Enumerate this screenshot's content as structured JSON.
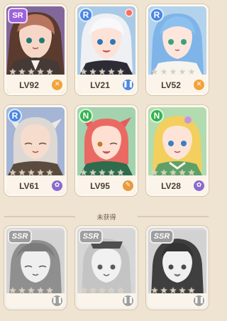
{
  "owned_heroes": [
    {
      "rarity": "SR",
      "level": "LV92",
      "class_icon": "crossed-swords-icon",
      "class_color": "#f2a33a",
      "bg": [
        "#9877a8",
        "#5f4f66"
      ],
      "stars": 5
    },
    {
      "rarity": "R",
      "level": "LV21",
      "class_icon": "pillars-icon",
      "class_color": "#4b86e3",
      "bg": [
        "#9ec3e3",
        "#6b8fb7"
      ],
      "stars": 5,
      "badge": true
    },
    {
      "rarity": "R",
      "level": "LV52",
      "class_icon": "star-shield-icon",
      "class_color": "#f2a33a",
      "bg": [
        "#b8d6ee",
        "#7fa9d1"
      ],
      "stars": 5
    },
    {
      "rarity": "R",
      "level": "LV61",
      "class_icon": "flower-icon",
      "class_color": "#8a6ad0",
      "bg": [
        "#a7b7d8",
        "#6f85b0"
      ],
      "stars": 5
    },
    {
      "rarity": "N",
      "level": "LV95",
      "class_icon": "staff-icon",
      "class_color": "#e89a3c",
      "bg": [
        "#a8d7b3",
        "#67a978"
      ],
      "stars": 5
    },
    {
      "rarity": "N",
      "level": "LV28",
      "class_icon": "flower-icon",
      "class_color": "#8a6ad0",
      "bg": [
        "#b9dfb6",
        "#79b57b"
      ],
      "stars": 5
    }
  ],
  "section_label": "未获得",
  "locked_heroes": [
    {
      "rarity": "SSR",
      "class_icon": "pillars-icon",
      "stars": 5
    },
    {
      "rarity": "SSR",
      "class_icon": "pillars-icon",
      "stars": 5
    },
    {
      "rarity": "SSR",
      "class_icon": "pillars-icon",
      "stars": 5
    }
  ]
}
